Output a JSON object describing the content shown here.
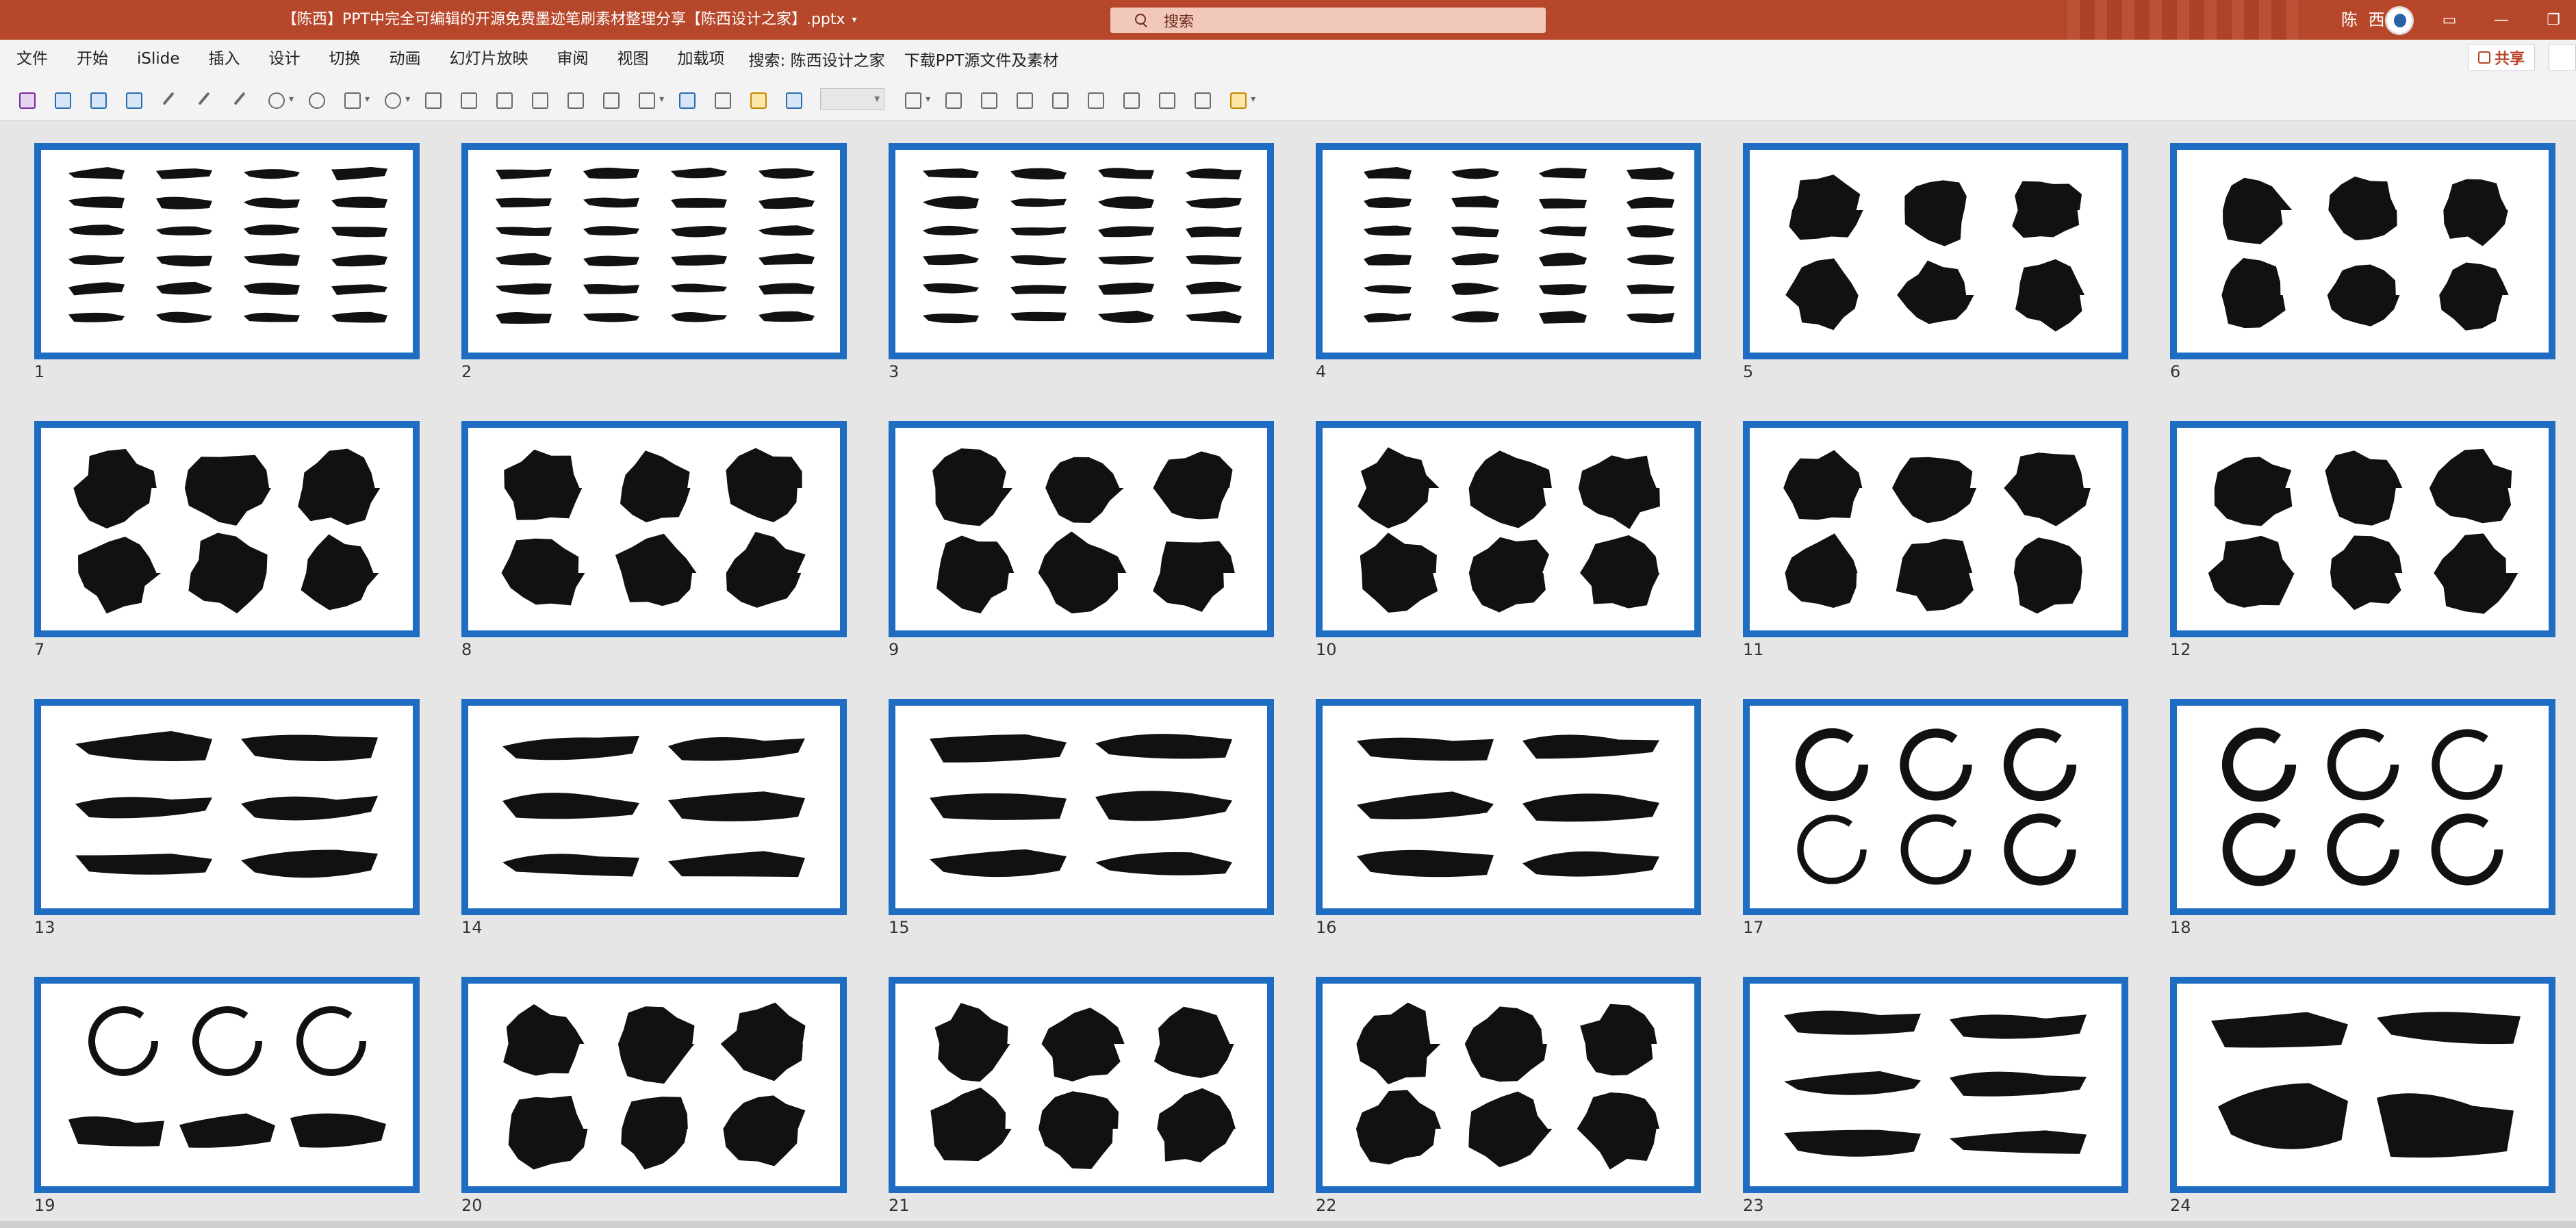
{
  "titlebar": {
    "doc_title": "【陈西】PPT中完全可编辑的开源免费墨迹笔刷素材整理分享【陈西设计之家】.pptx",
    "search_placeholder": "搜索",
    "user_name": "陈 西",
    "accent_color": "#b7472a"
  },
  "menu": {
    "items": [
      "文件",
      "开始",
      "iSlide",
      "插入",
      "设计",
      "切换",
      "动画",
      "幻灯片放映",
      "审阅",
      "视图",
      "加载项"
    ],
    "search_text": "搜索: 陈西设计之家",
    "download_text": "下载PPT源文件及素材",
    "share_label": "共享"
  },
  "slides": {
    "selection_color": "#1e6dc3",
    "items": [
      {
        "number": "1",
        "kind": "strokes4x6"
      },
      {
        "number": "2",
        "kind": "strokes4x6"
      },
      {
        "number": "3",
        "kind": "strokes4x6"
      },
      {
        "number": "4",
        "kind": "strokes4x6b"
      },
      {
        "number": "5",
        "kind": "splash3x2"
      },
      {
        "number": "6",
        "kind": "splash3x2"
      },
      {
        "number": "7",
        "kind": "blob3x2"
      },
      {
        "number": "8",
        "kind": "blob3x2"
      },
      {
        "number": "9",
        "kind": "blob3x2"
      },
      {
        "number": "10",
        "kind": "blob3x2"
      },
      {
        "number": "11",
        "kind": "blob3x2"
      },
      {
        "number": "12",
        "kind": "blob3x2"
      },
      {
        "number": "13",
        "kind": "brush2x3"
      },
      {
        "number": "14",
        "kind": "brush2x3"
      },
      {
        "number": "15",
        "kind": "brush2x3"
      },
      {
        "number": "16",
        "kind": "brush2x3"
      },
      {
        "number": "17",
        "kind": "ring3x2"
      },
      {
        "number": "18",
        "kind": "ring3x2"
      },
      {
        "number": "19",
        "kind": "ringmix"
      },
      {
        "number": "20",
        "kind": "blob3x2"
      },
      {
        "number": "21",
        "kind": "blob3x2"
      },
      {
        "number": "22",
        "kind": "blob3x2"
      },
      {
        "number": "23",
        "kind": "brush2x3"
      },
      {
        "number": "24",
        "kind": "brush2x2"
      }
    ]
  }
}
